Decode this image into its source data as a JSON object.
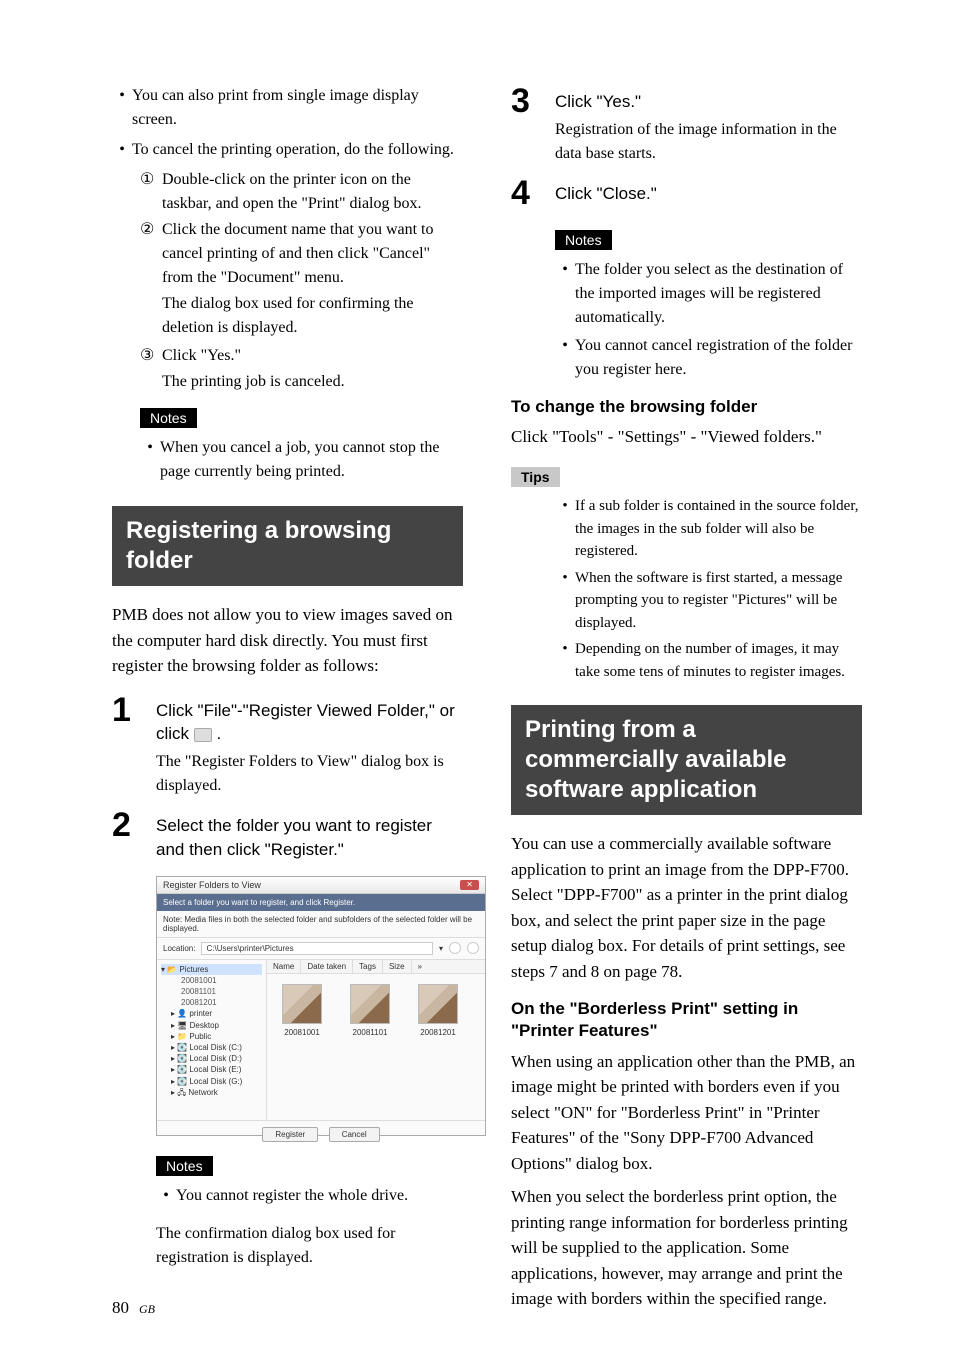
{
  "left": {
    "b1": "You can also print from single image display screen.",
    "b2": "To cancel the printing operation, do the following.",
    "c1": "Double-click on the printer icon on the taskbar, and open the \"Print\" dialog box.",
    "c2": "Click the document name that you want to cancel printing of and then click \"Cancel\" from the \"Document\" menu.",
    "c2b": "The dialog box used for confirming the deletion is displayed.",
    "c3": "Click \"Yes.\"",
    "c3b": "The printing job is canceled.",
    "notesLabel": "Notes",
    "n1": "When you cancel a job, you cannot stop the page currently being printed.",
    "sec1": "Registering a browsing folder",
    "p1": "PMB does not allow you to view images saved on the computer hard disk directly. You must first register the browsing folder as follows:",
    "s1t_a": "Click \"File\"-\"Register Viewed Folder,\" or click ",
    "s1t_b": " .",
    "s1x": "The \"Register Folders to View\" dialog box is displayed.",
    "s2t": "Select the folder you want to register and then click \"Register.\"",
    "notesLabel2": "Notes",
    "n2": "You cannot register the whole drive.",
    "confirm": "The confirmation dialog box used for registration is displayed."
  },
  "right": {
    "s3t": "Click \"Yes.\"",
    "s3x": "Registration of the image information in the data base starts.",
    "s4t": "Click \"Close.\"",
    "notesLabel": "Notes",
    "rn1": "The folder you select as the destination of the imported images will be registered automatically.",
    "rn2": "You cannot cancel registration of the folder you register here.",
    "sub1": "To change the browsing folder",
    "sub1p": "Click \"Tools\" - \"Settings\" - \"Viewed folders.\"",
    "tipsLabel": "Tips",
    "t1": "If a sub folder is contained in the source folder, the images in the sub folder will also be registered.",
    "t2": "When the software is first started, a message prompting you to register \"Pictures\" will be displayed.",
    "t3": "Depending on the number of images, it may take some tens of minutes to register images.",
    "sec2": "Printing from a commercially available software application",
    "p2": "You can use a commercially available software application to print an image from the DPP-F700. Select \"DPP-F700\" as a printer in the print dialog box, and select the print paper size in the page setup dialog box. For details of print settings, see steps 7 and 8 on page 78.",
    "sub2": "On the \"Borderless Print\" setting in \"Printer Features\"",
    "p3": "When using an application other than the PMB, an image might be printed with borders even if you select \"ON\" for  \"Borderless Print\" in \"Printer Features\" of the \"Sony DPP-F700 Advanced Options\" dialog box.",
    "p4": "When you select the borderless print option, the printing range information for borderless printing will be supplied to the application. Some applications, however, may arrange and print the image with borders within the specified range."
  },
  "screenshot": {
    "title": "Register Folders to View",
    "sub": "Select a folder you want to register, and click Register.",
    "note": "Note: Media files in both the selected folder and subfolders of the selected folder will be displayed.",
    "locLabel": "Location:",
    "locPath": "C:\\Users\\printer\\Pictures",
    "tree": {
      "pictures": "Pictures",
      "f1": "20081001",
      "f2": "20081101",
      "f3": "20081201",
      "printer": "printer",
      "desktop": "Desktop",
      "public": "Public",
      "dc": "Local Disk (C:)",
      "dd": "Local Disk (D:)",
      "de": "Local Disk (E:)",
      "dg": "Local Disk (G:)",
      "net": "Network"
    },
    "cols": {
      "name": "Name",
      "date": "Date taken",
      "tags": "Tags",
      "size": "Size"
    },
    "thumbs": {
      "a": "20081001",
      "b": "20081101",
      "c": "20081201"
    },
    "register": "Register",
    "cancel": "Cancel"
  },
  "steps": {
    "one": "1",
    "two": "2",
    "three": "3",
    "four": "4"
  },
  "circ": {
    "one": "①",
    "two": "②",
    "three": "③"
  },
  "footer": {
    "num": "80",
    "gb": "GB"
  }
}
